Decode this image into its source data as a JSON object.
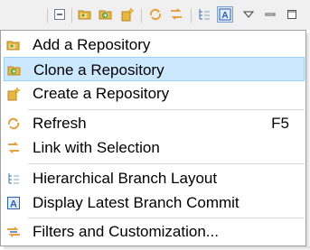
{
  "toolbar": {
    "buttons": [
      {
        "icon": "collapse-all-icon"
      },
      {
        "icon": "add-repository-icon"
      },
      {
        "icon": "clone-repository-icon"
      },
      {
        "icon": "create-repository-icon"
      },
      {
        "icon": "refresh-icon"
      },
      {
        "icon": "link-with-selection-icon"
      },
      {
        "icon": "hierarchical-layout-icon"
      },
      {
        "icon": "display-latest-commit-icon",
        "pressed": true
      },
      {
        "icon": "view-menu-icon"
      },
      {
        "icon": "minimize-icon"
      },
      {
        "icon": "maximize-icon"
      }
    ]
  },
  "menu": {
    "items": [
      {
        "label": "Add a Repository",
        "icon": "add-repository-icon"
      },
      {
        "label": "Clone a Repository",
        "icon": "clone-repository-icon",
        "selected": true
      },
      {
        "label": "Create a Repository",
        "icon": "create-repository-icon"
      },
      {
        "label": "Refresh",
        "accelerator": "F5",
        "icon": "refresh-icon"
      },
      {
        "label": "Link with Selection",
        "icon": "link-with-selection-icon"
      },
      {
        "label": "Hierarchical Branch Layout",
        "icon": "hierarchical-layout-icon"
      },
      {
        "label": "Display Latest Branch Commit",
        "icon": "display-latest-commit-icon"
      },
      {
        "label": "Filters and Customization...",
        "icon": "filter-icon"
      }
    ]
  },
  "colors": {
    "selection_bg": "#cce8ff",
    "selection_border": "#99d1ff",
    "folder": "#e8b73c",
    "orange": "#f29b25",
    "green": "#4aa54a",
    "blue": "#2b5fb3"
  }
}
